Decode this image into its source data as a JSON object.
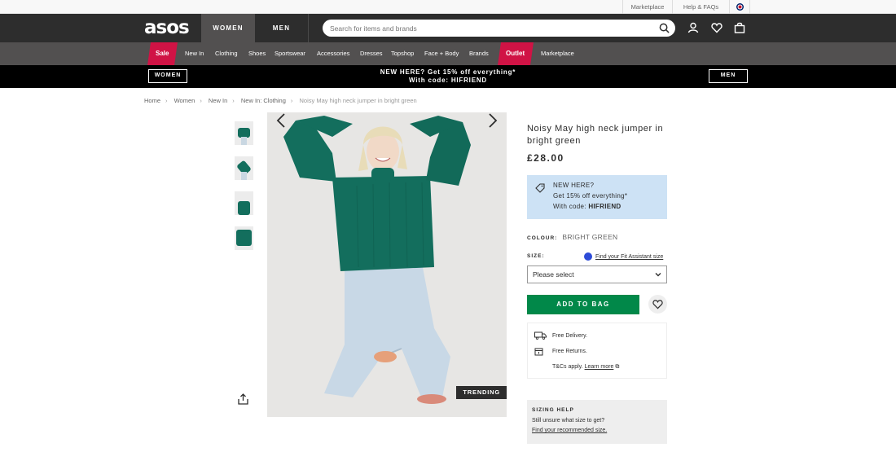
{
  "utility_bar": {
    "marketplace": "Marketplace",
    "help": "Help & FAQs",
    "flag_icon": "uk-flag-icon"
  },
  "header": {
    "logo": "asos",
    "tabs": [
      "WOMEN",
      "MEN"
    ],
    "search_placeholder": "Search for items and brands",
    "icons": [
      "account-icon",
      "saved-items-icon",
      "bag-icon"
    ]
  },
  "nav": {
    "items": [
      {
        "label": "Sale"
      },
      {
        "label": "New In"
      },
      {
        "label": "Clothing"
      },
      {
        "label": "Shoes"
      },
      {
        "label": "Sportswear"
      },
      {
        "label": "Accessories"
      },
      {
        "label": "Dresses"
      },
      {
        "label": "Topshop"
      },
      {
        "label": "Face + Body"
      },
      {
        "label": "Brands"
      },
      {
        "label": "Outlet"
      },
      {
        "label": "Marketplace"
      }
    ]
  },
  "promo": {
    "left_button": "WOMEN",
    "line1": "NEW HERE? Get 15% off everything*",
    "line2": "With code: HIFRIEND",
    "right_button": "MEN"
  },
  "breadcrumb": [
    "Home",
    "Women",
    "New In",
    "New In: Clothing",
    "Noisy May high neck jumper in bright green"
  ],
  "gallery": {
    "badge": "TRENDING",
    "thumb_count": 4
  },
  "product": {
    "name": "Noisy May high neck jumper in bright green",
    "price": "£28.00",
    "promo_box": {
      "line1": "NEW HERE?",
      "line2": "Get 15% off everything*",
      "line3_prefix": "With code: ",
      "code": "HIFRIEND"
    },
    "colour_label": "COLOUR:",
    "colour_value": "BRIGHT GREEN",
    "size_label": "SIZE:",
    "fit_assistant": "Find your Fit Assistant size",
    "size_select": "Please select",
    "add_to_bag": "ADD TO BAG",
    "delivery": {
      "free_delivery": "Free Delivery.",
      "free_returns": "Free Returns.",
      "tcs_prefix": "T&Cs apply. ",
      "learn_more": "Learn more"
    },
    "sizing_help": {
      "title": "SIZING HELP",
      "line1": "Still unsure what size to get?",
      "link": "Find your recommended size."
    }
  },
  "colors": {
    "header_bg": "#2d2d2d",
    "nav_bg": "#525050",
    "sale": "#d01345",
    "add_to_bag": "#018849",
    "promo_box": "#cde2f5",
    "jumper": "#136e5d"
  }
}
